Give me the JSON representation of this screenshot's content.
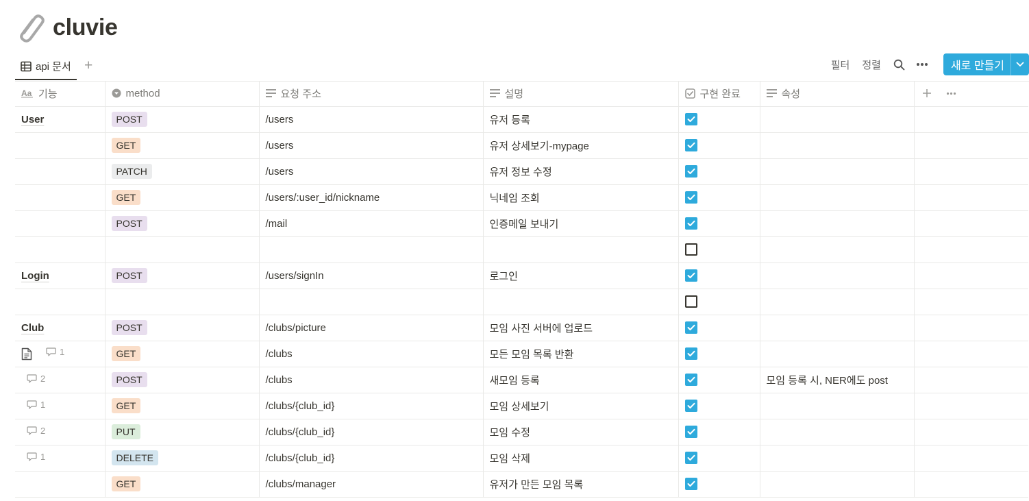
{
  "page": {
    "title": "cluvie",
    "icon": "paperclip-icon"
  },
  "view": {
    "tab_label": "api 문서",
    "add_view_label": "+",
    "filter_label": "필터",
    "sort_label": "정렬",
    "new_button_label": "새로 만들기"
  },
  "columns": {
    "name": "기능",
    "method": "method",
    "path": "요청 주소",
    "desc": "설명",
    "done": "구현 완료",
    "prop": "속성"
  },
  "colors": {
    "accent": "#2eaadc",
    "tag_post": "#e8deee",
    "tag_get": "#fadec9",
    "tag_patch": "#ebeced",
    "tag_put": "#dbeddb",
    "tag_delete": "#d3e5ef"
  },
  "rows": [
    {
      "name": "User",
      "method": "POST",
      "path": "/users",
      "desc": "유저 등록",
      "done": true,
      "prop": "",
      "comments": "",
      "doc": false
    },
    {
      "name": "",
      "method": "GET",
      "path": "/users",
      "desc": "유저 상세보기-mypage",
      "done": true,
      "prop": "",
      "comments": "",
      "doc": false
    },
    {
      "name": "",
      "method": "PATCH",
      "path": "/users",
      "desc": "유저 정보 수정",
      "done": true,
      "prop": "",
      "comments": "",
      "doc": false
    },
    {
      "name": "",
      "method": "GET",
      "path": "/users/:user_id/nickname",
      "desc": "닉네임 조회",
      "done": true,
      "prop": "",
      "comments": "",
      "doc": false
    },
    {
      "name": "",
      "method": "POST",
      "path": "/mail",
      "desc": "인증메일 보내기",
      "done": true,
      "prop": "",
      "comments": "",
      "doc": false
    },
    {
      "name": "",
      "method": "",
      "path": "",
      "desc": "",
      "done": false,
      "prop": "",
      "comments": "",
      "doc": false
    },
    {
      "name": "Login",
      "method": "POST",
      "path": "/users/signIn",
      "desc": "로그인",
      "done": true,
      "prop": "",
      "comments": "",
      "doc": false
    },
    {
      "name": "",
      "method": "",
      "path": "",
      "desc": "",
      "done": false,
      "prop": "",
      "comments": "",
      "doc": false
    },
    {
      "name": "Club",
      "method": "POST",
      "path": "/clubs/picture",
      "desc": "모임 사진 서버에 업로드",
      "done": true,
      "prop": "",
      "comments": "",
      "doc": false
    },
    {
      "name": "",
      "method": "GET",
      "path": "/clubs",
      "desc": "모든 모임 목록 반환",
      "done": true,
      "prop": "",
      "comments": "1",
      "doc": true
    },
    {
      "name": "",
      "method": "POST",
      "path": "/clubs",
      "desc": "새모임 등록",
      "done": true,
      "prop": "모임 등록 시, NER에도 post",
      "comments": "2",
      "doc": false
    },
    {
      "name": "",
      "method": "GET",
      "path": "/clubs/{club_id}",
      "desc": "모임 상세보기",
      "done": true,
      "prop": "",
      "comments": "1",
      "doc": false
    },
    {
      "name": "",
      "method": "PUT",
      "path": "/clubs/{club_id}",
      "desc": "모임 수정",
      "done": true,
      "prop": "",
      "comments": "2",
      "doc": false
    },
    {
      "name": "",
      "method": "DELETE",
      "path": "/clubs/{club_id}",
      "desc": "모임 삭제",
      "done": true,
      "prop": "",
      "comments": "1",
      "doc": false
    },
    {
      "name": "",
      "method": "GET",
      "path": "/clubs/manager",
      "desc": "유저가 만든 모임 목록",
      "done": true,
      "prop": "",
      "comments": "",
      "doc": false
    }
  ]
}
